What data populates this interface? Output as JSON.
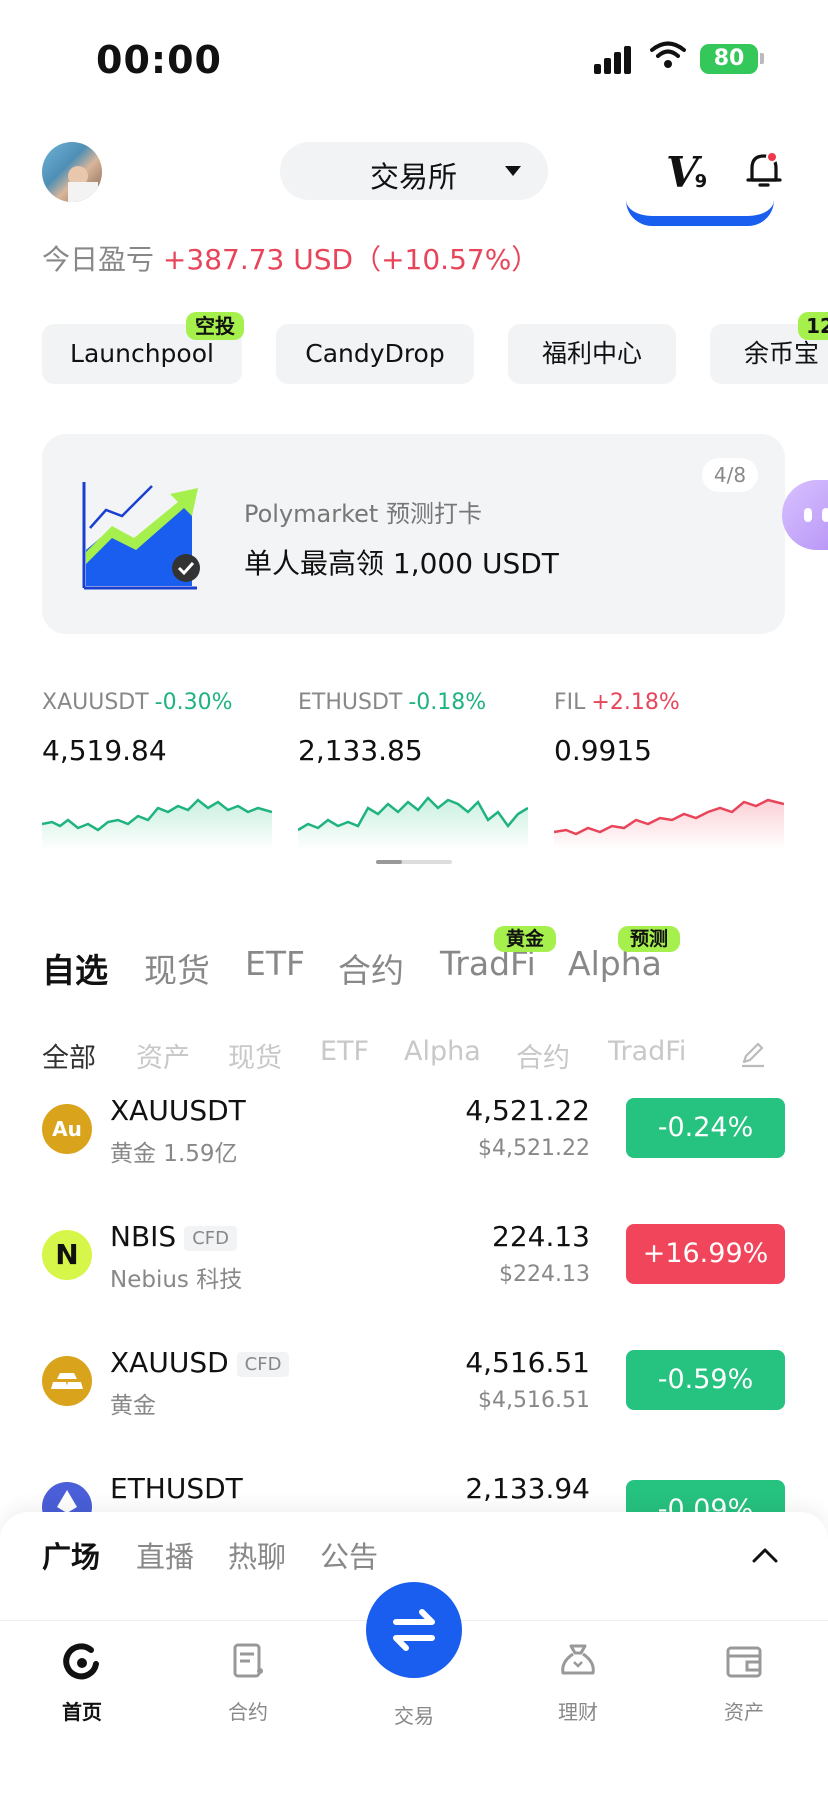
{
  "status_bar": {
    "time": "00:00",
    "battery": "80"
  },
  "header": {
    "exchange_label": "交易所",
    "vip_letter": "V",
    "vip_level": "9"
  },
  "pnl": {
    "label": "今日盈亏",
    "value": "+387.73 USD（+10.57%）"
  },
  "quick_links": [
    {
      "label": "Launchpool",
      "badge": "空投"
    },
    {
      "label": "CandyDrop",
      "badge": ""
    },
    {
      "label": "福利中心",
      "badge": ""
    },
    {
      "label": "余币宝",
      "badge": "12"
    }
  ],
  "banner": {
    "page": "4/8",
    "title": "Polymarket 预测打卡",
    "subtitle": "单人最高领 1,000 USDT"
  },
  "tickers": [
    {
      "symbol": "XAUUSDT",
      "change": "-0.30%",
      "price": "4,519.84",
      "direction": "down"
    },
    {
      "symbol": "ETHUSDT",
      "change": "-0.18%",
      "price": "2,133.85",
      "direction": "down"
    },
    {
      "symbol": "FIL",
      "change": "+2.18%",
      "price": "0.9915",
      "direction": "up"
    }
  ],
  "main_tabs": [
    {
      "label": "自选",
      "badge": ""
    },
    {
      "label": "现货",
      "badge": ""
    },
    {
      "label": "ETF",
      "badge": ""
    },
    {
      "label": "合约",
      "badge": ""
    },
    {
      "label": "TradFi",
      "badge": "黄金"
    },
    {
      "label": "Alpha",
      "badge": "预测"
    }
  ],
  "sub_tabs": [
    "全部",
    "资产",
    "现货",
    "ETF",
    "Alpha",
    "合约",
    "TradFi"
  ],
  "watchlist": [
    {
      "icon_text": "Au",
      "symbol": "XAUUSDT",
      "tag": "",
      "name": "黄金 1.59亿",
      "price": "4,521.22",
      "price_usd": "$4,521.22",
      "change": "-0.24%",
      "direction": "down"
    },
    {
      "icon_text": "N",
      "symbol": "NBIS",
      "tag": "CFD",
      "name": "Nebius 科技",
      "price": "224.13",
      "price_usd": "$224.13",
      "change": "+16.99%",
      "direction": "up"
    },
    {
      "icon_text": "",
      "symbol": "XAUUSD",
      "tag": "CFD",
      "name": "黄金",
      "price": "4,516.51",
      "price_usd": "$4,516.51",
      "change": "-0.59%",
      "direction": "down"
    },
    {
      "icon_text": "",
      "symbol": "ETHUSDT",
      "tag": "",
      "name": "",
      "price": "2,133.94",
      "price_usd": "",
      "change": "-0.09%",
      "direction": "down"
    }
  ],
  "sheet_tabs": [
    "广场",
    "直播",
    "热聊",
    "公告"
  ],
  "nav": {
    "home": "首页",
    "futures": "合约",
    "trade": "交易",
    "earn": "理财",
    "assets": "资产"
  },
  "colors": {
    "up": "#f0455a",
    "down": "#26c27f",
    "accent": "#1a5ef0",
    "badge": "#a6f04e"
  }
}
